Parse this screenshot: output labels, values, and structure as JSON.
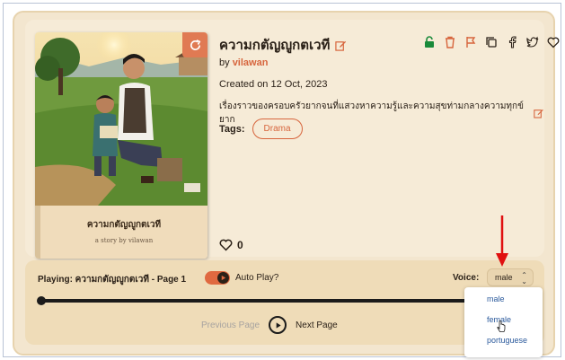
{
  "story": {
    "title": "ความกตัญญูกตเวที",
    "by_prefix": "by",
    "author": "vilawan",
    "created": "Created on 12 Oct, 2023",
    "description": "เรื่องราวของครอบครัวยากจนที่แสวงหาความรู้และความสุขท่ามกลางความทุกข์ยาก",
    "tags_label": "Tags:",
    "tags": [
      "Drama"
    ],
    "likes": "0"
  },
  "cover": {
    "title": "ความกตัญญูกตเวที",
    "byline": "a story by vilawan"
  },
  "actions": [
    "lock-open-icon",
    "trash-icon",
    "flag-icon",
    "copy-icon",
    "facebook-icon",
    "twitter-icon",
    "heart-icon"
  ],
  "player": {
    "playing": "Playing: ความกตัญญูกตเวที - Page 1",
    "autoplay_label": "Auto Play?",
    "voice_label": "Voice:",
    "voice_selected": "male",
    "prev": "Previous Page",
    "next": "Next Page"
  },
  "voice_options": [
    "male",
    "female",
    "portuguese"
  ],
  "colors": {
    "accent": "#d7653d",
    "card_bg": "#f3e6cf",
    "player_bg": "#efdcb8",
    "lock_green": "#1a8a3a",
    "arrow_red": "#e01010"
  }
}
